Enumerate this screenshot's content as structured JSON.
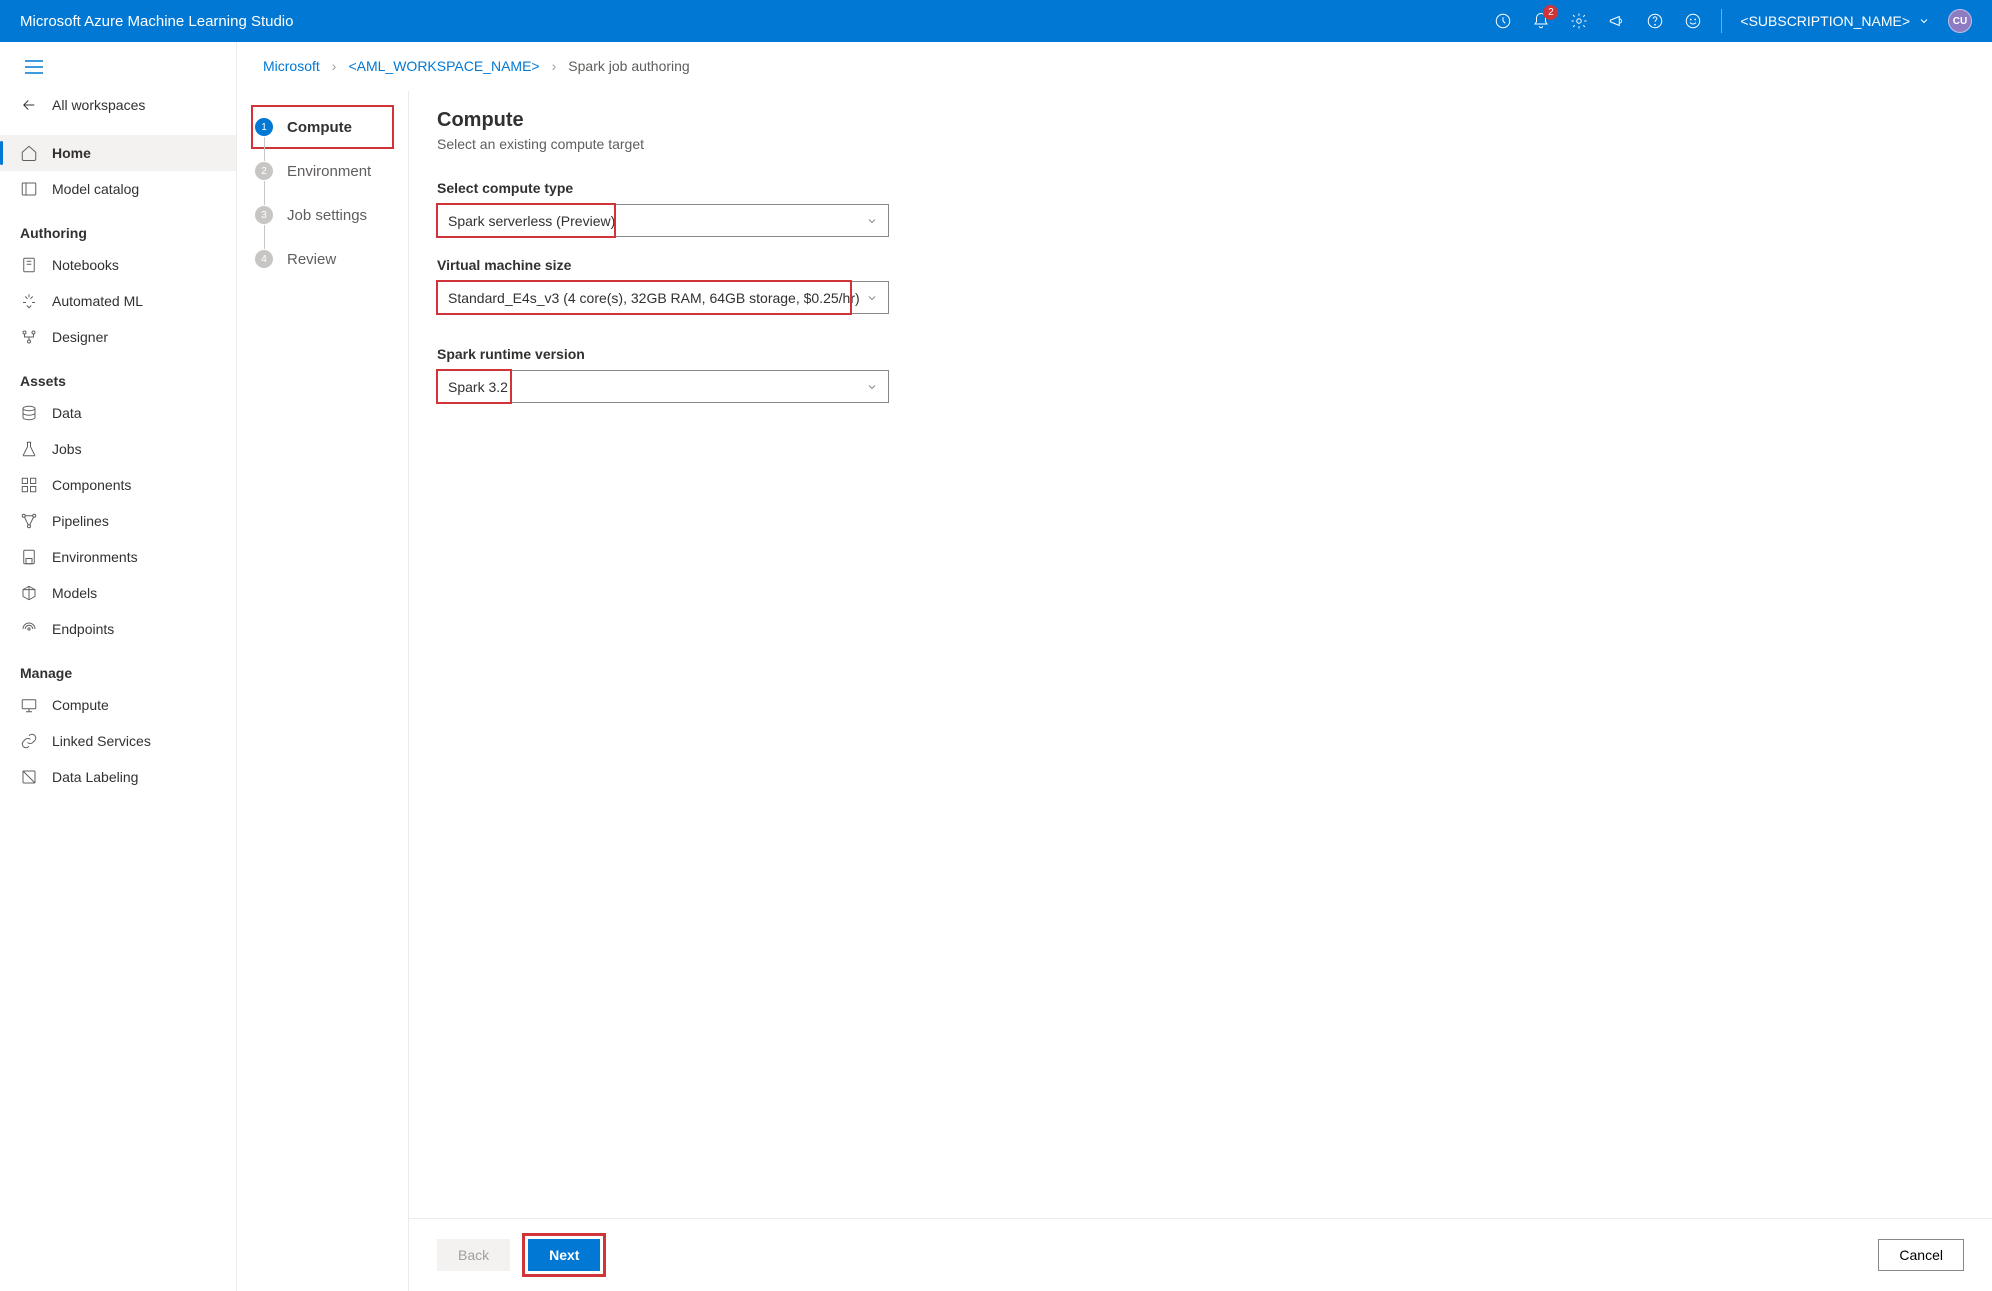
{
  "header": {
    "title": "Microsoft Azure Machine Learning Studio",
    "notification_count": "2",
    "subscription": "<SUBSCRIPTION_NAME>",
    "avatar": "CU"
  },
  "sidebar": {
    "all_workspaces": "All workspaces",
    "home": "Home",
    "model_catalog": "Model catalog",
    "section_authoring": "Authoring",
    "notebooks": "Notebooks",
    "automated_ml": "Automated ML",
    "designer": "Designer",
    "section_assets": "Assets",
    "data": "Data",
    "jobs": "Jobs",
    "components": "Components",
    "pipelines": "Pipelines",
    "environments": "Environments",
    "models": "Models",
    "endpoints": "Endpoints",
    "section_manage": "Manage",
    "compute": "Compute",
    "linked_services": "Linked Services",
    "data_labeling": "Data Labeling"
  },
  "breadcrumb": {
    "root": "Microsoft",
    "workspace": "<AML_WORKSPACE_NAME>",
    "current": "Spark job authoring"
  },
  "steps": {
    "s1": "Compute",
    "s2": "Environment",
    "s3": "Job settings",
    "s4": "Review"
  },
  "form": {
    "title": "Compute",
    "subtitle": "Select an existing compute target",
    "label_compute_type": "Select compute type",
    "value_compute_type": "Spark serverless (Preview)",
    "label_vm_size": "Virtual machine size",
    "value_vm_size": "Standard_E4s_v3 (4 core(s), 32GB RAM, 64GB storage, $0.25/hr)",
    "label_runtime": "Spark runtime version",
    "value_runtime": "Spark 3.2"
  },
  "footer": {
    "back": "Back",
    "next": "Next",
    "cancel": "Cancel"
  }
}
